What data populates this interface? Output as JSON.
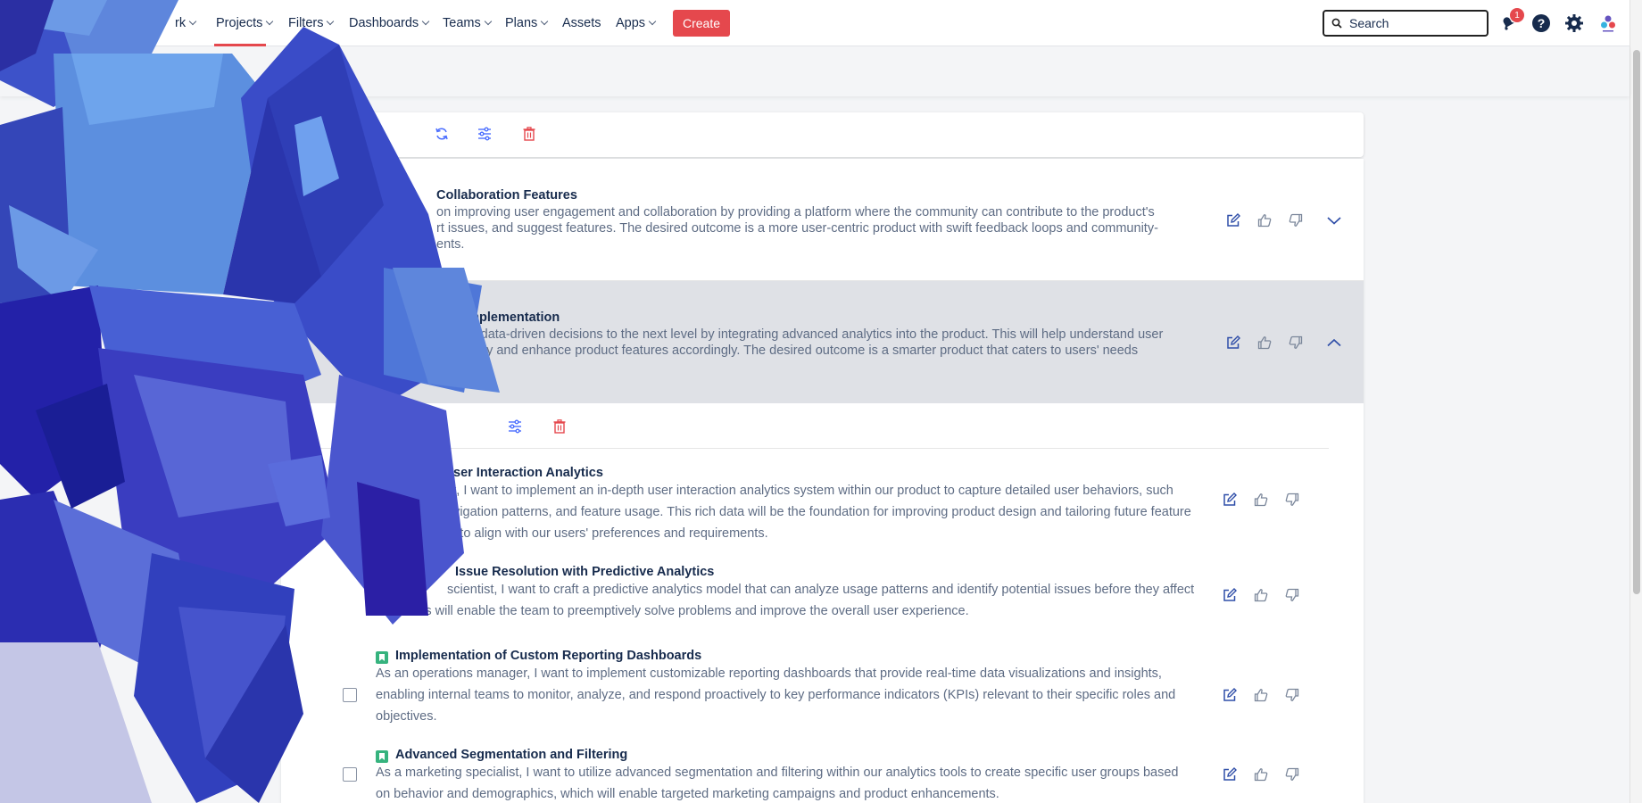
{
  "nav": {
    "items": [
      {
        "label": "rk",
        "has_chevron": true
      },
      {
        "label": "Projects",
        "has_chevron": true
      },
      {
        "label": "Filters",
        "has_chevron": true
      },
      {
        "label": "Dashboards",
        "has_chevron": true
      },
      {
        "label": "Teams",
        "has_chevron": true
      },
      {
        "label": "Plans",
        "has_chevron": true
      },
      {
        "label": "Assets",
        "has_chevron": false
      },
      {
        "label": "Apps",
        "has_chevron": true
      }
    ],
    "create_label": "Create",
    "search_placeholder": "Search",
    "notification_count": "1",
    "accent_color": "#e5484d"
  },
  "epics": [
    {
      "title": "Collaboration Features",
      "desc_lines": [
        "on improving user engagement and collaboration by providing a platform where the community can contribute to the product's",
        "rt issues, and suggest features. The desired outcome is a more user-centric product with swift feedback loops and community-",
        "ents."
      ],
      "expanded": false
    },
    {
      "title": "s Implementation",
      "desc_lines": [
        "king data-driven decisions to the next level by integrating advanced analytics into the product. This will help understand user",
        "nsively and enhance product features accordingly. The desired outcome is a smarter product that caters to users' needs"
      ],
      "expanded": true
    }
  ],
  "stories": [
    {
      "title": "ser Interaction Analytics",
      "desc_lines": [
        "st, I want to implement an in-depth user interaction analytics system within our product to capture detailed user behaviors, such",
        "avigation patterns, and feature usage. This rich data will be the foundation for improving product design and tailoring future feature",
        "ts to align with our users' preferences and requirements."
      ]
    },
    {
      "title": "Issue Resolution with Predictive Analytics",
      "desc_lines": [
        "scientist, I want to craft a predictive analytics model that can analyze usage patterns and identify potential issues before they affect",
        "use . This will enable the team to preemptively solve problems and improve the overall user experience."
      ]
    },
    {
      "title": "Implementation of Custom Reporting Dashboards",
      "desc_lines": [
        "As an operations manager, I want to implement customizable reporting dashboards that provide real-time data visualizations and insights,",
        "enabling internal teams to monitor, analyze, and respond proactively to key performance indicators (KPIs) relevant to their specific roles and",
        "objectives."
      ]
    },
    {
      "title": "Advanced Segmentation and Filtering",
      "desc_lines": [
        "As a marketing specialist, I want to utilize advanced segmentation and filtering within our analytics tools to create specific user groups based",
        "on behavior and demographics, which will enable targeted marketing campaigns and product enhancements."
      ]
    }
  ],
  "icons": {
    "toolbar": [
      "refresh-icon",
      "sliders-icon",
      "trash-icon"
    ],
    "row_actions": [
      "edit-icon",
      "thumbs-up-icon",
      "thumbs-down-icon"
    ]
  }
}
